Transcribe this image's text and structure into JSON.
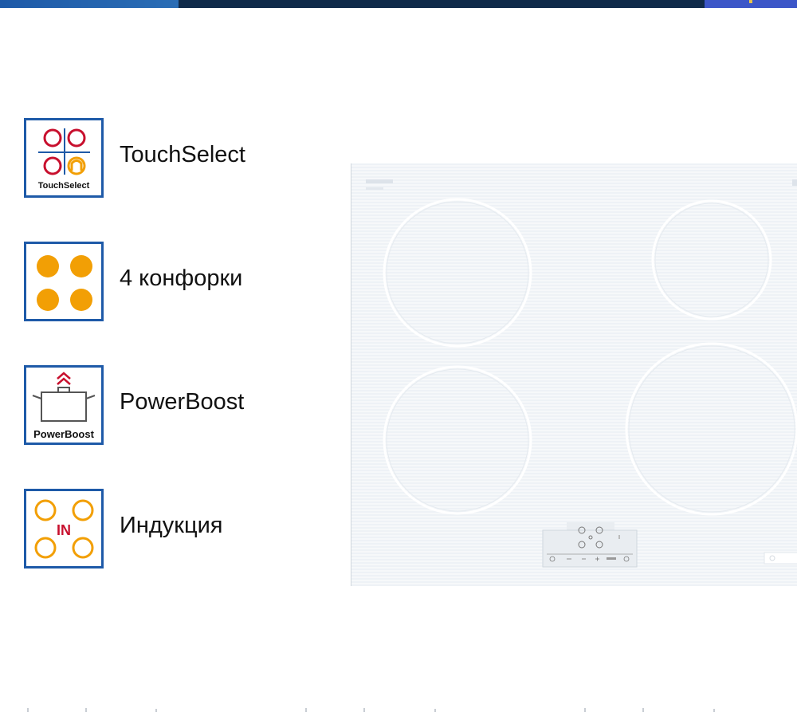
{
  "features": [
    {
      "id": "touchselect",
      "label": "TouchSelect",
      "icon": "touchselect-icon",
      "icon_text": "TouchSelect"
    },
    {
      "id": "burners",
      "label": "4 конфорки",
      "icon": "four-burners-icon"
    },
    {
      "id": "powerboost",
      "label": "PowerBoost",
      "icon": "powerboost-icon",
      "icon_text": "PowerBoost"
    },
    {
      "id": "induction",
      "label": "Индукция",
      "icon": "induction-icon",
      "icon_text": "IN"
    }
  ],
  "hob": {
    "burner_count": 4
  },
  "colors": {
    "brand_blue": "#1e5aa8",
    "dark_bar": "#0f2a4a",
    "accent_red": "#c8102e",
    "accent_orange": "#f29f05"
  }
}
